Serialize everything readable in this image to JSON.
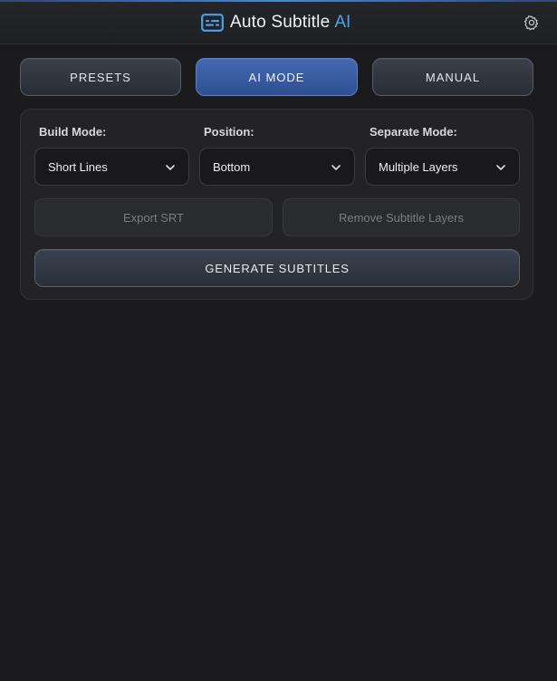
{
  "header": {
    "title": "Auto Subtitle",
    "title_accent": "AI",
    "logo_icon": "subtitles-icon",
    "settings_icon": "gear-icon",
    "accent_color": "#4da0ee"
  },
  "tabs": [
    {
      "label": "PRESETS",
      "active": false
    },
    {
      "label": "AI MODE",
      "active": true
    },
    {
      "label": "MANUAL",
      "active": false
    }
  ],
  "panel": {
    "build_mode": {
      "label": "Build Mode:",
      "value": "Short Lines"
    },
    "position": {
      "label": "Position:",
      "value": "Bottom"
    },
    "separate_mode": {
      "label": "Separate Mode:",
      "value": "Multiple Layers"
    },
    "export_label": "Export SRT",
    "remove_label": "Remove Subtitle Layers",
    "generate_label": "GENERATE SUBTITLES"
  }
}
